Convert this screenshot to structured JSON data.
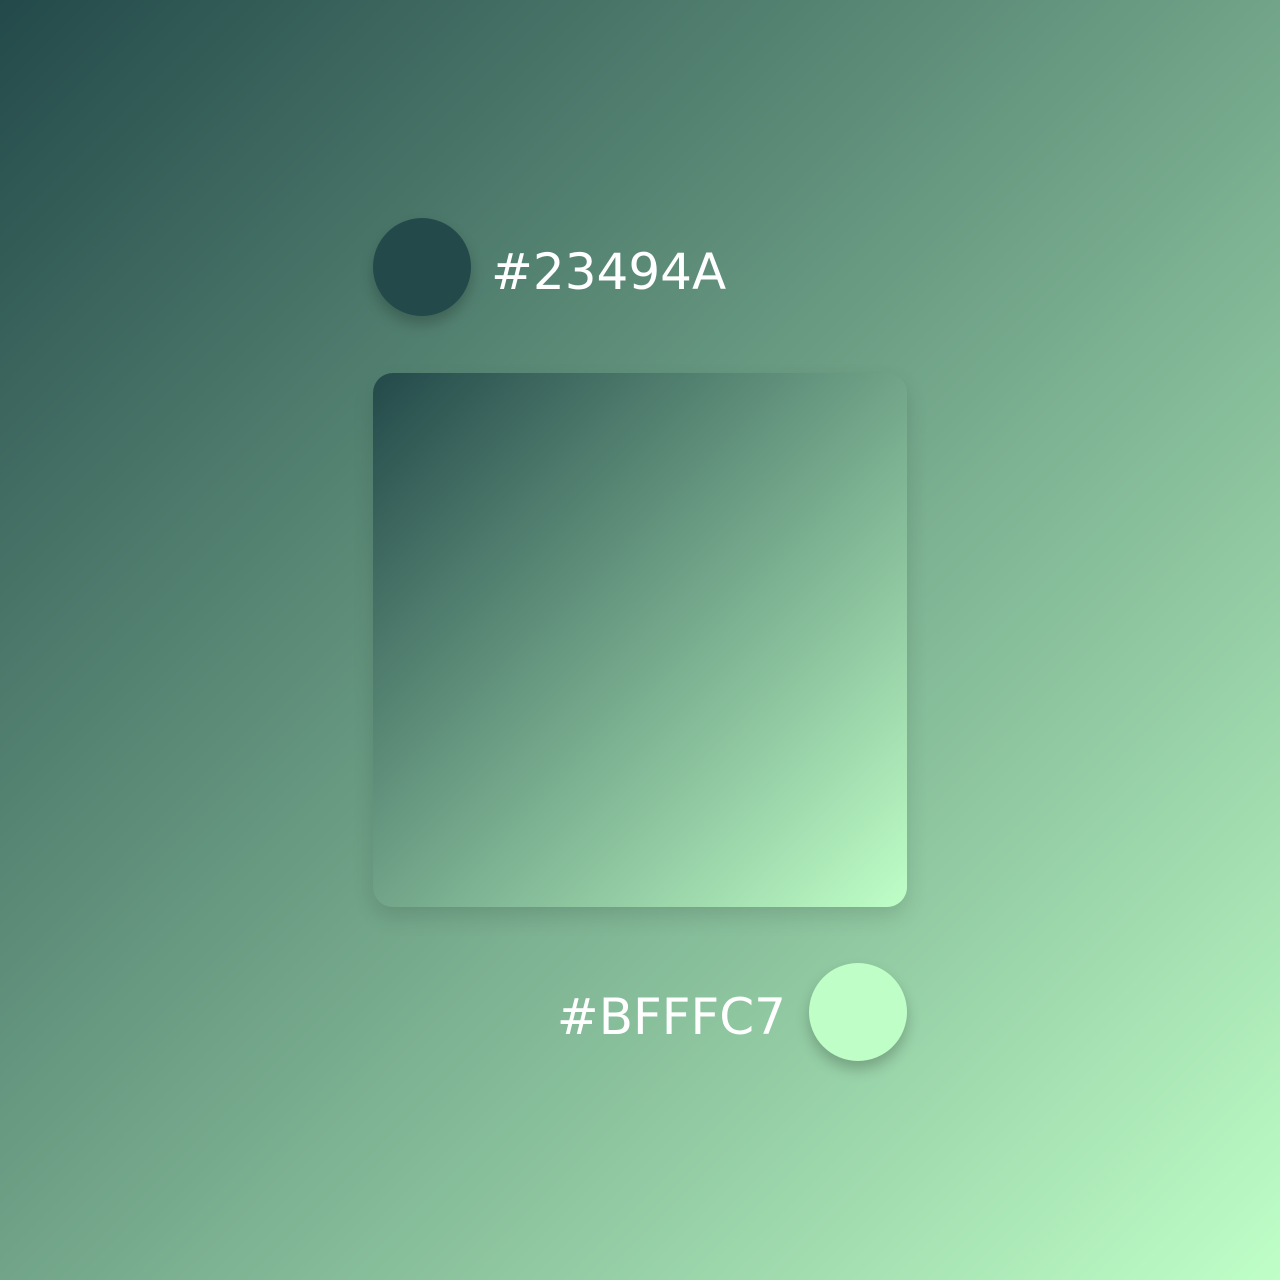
{
  "gradient": {
    "start_color": "#23494A",
    "end_color": "#BFFFC7",
    "start_label": "#23494A",
    "end_label": "#BFFFC7"
  }
}
